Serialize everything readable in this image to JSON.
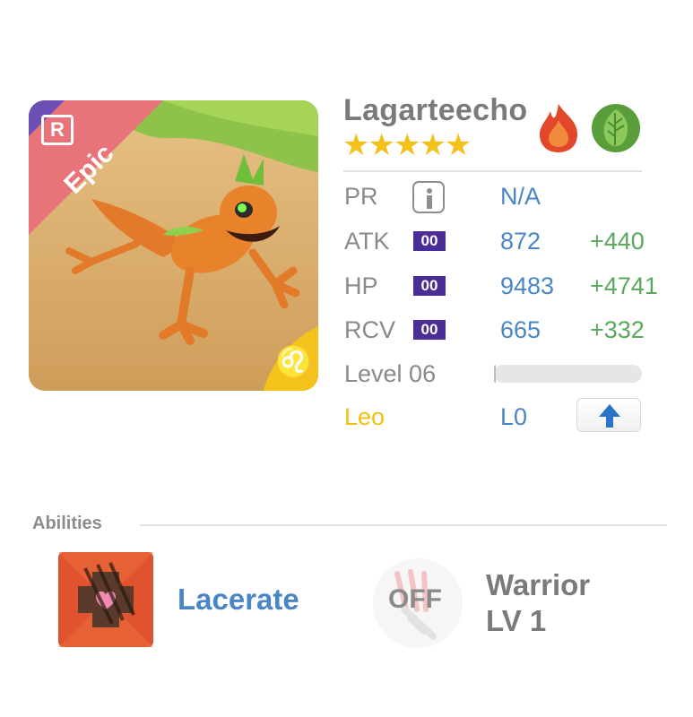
{
  "creature": {
    "name": "Lagarteecho",
    "rarity": "Epic",
    "rarity_badge": "R",
    "stars": "★★★★★",
    "star_count": 5,
    "elements": [
      "fire-element-icon",
      "nature-leaf-element-icon"
    ],
    "sign_glyph": "♌"
  },
  "stats": {
    "pr": {
      "label": "PR",
      "value": "N/A"
    },
    "atk": {
      "label": "ATK",
      "badge": "00",
      "value": "872",
      "bonus": "+440"
    },
    "hp": {
      "label": "HP",
      "badge": "00",
      "value": "9483",
      "bonus": "+4741"
    },
    "rcv": {
      "label": "RCV",
      "badge": "00",
      "value": "665",
      "bonus": "+332"
    },
    "level": {
      "label": "Level 06",
      "progress": 0.01
    },
    "sign": {
      "label": "Leo",
      "value": "L0"
    }
  },
  "abilities": {
    "title": "Abilities",
    "active": {
      "name": "Lacerate",
      "icon": "lacerate-icon"
    },
    "passive": {
      "state": "OFF",
      "name": "Warrior",
      "level": "LV 1",
      "icon": "warrior-claw-icon"
    }
  },
  "colors": {
    "rarity_ribbon": "#e8747a",
    "rarity_badge_bg": "#6b4fb5",
    "name_gray": "#7a7a7a",
    "value_blue": "#4a86c5",
    "bonus_green": "#5aa85c",
    "leo_yellow": "#f2c10e",
    "badge_purple": "#4a2d96"
  }
}
